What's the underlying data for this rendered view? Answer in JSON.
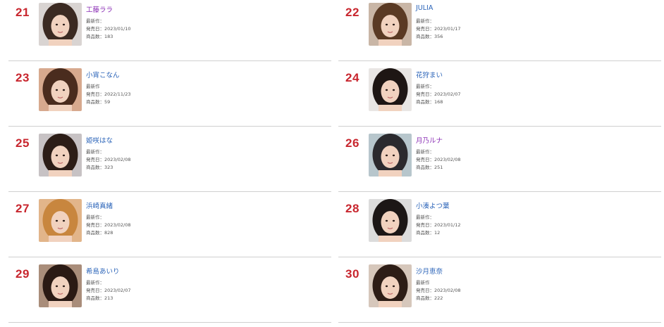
{
  "ranking": [
    {
      "rank": "21",
      "name": "工藤ララ",
      "latest_label": "最新作：",
      "release_label": "発売日：",
      "release_date": "2023/01/10",
      "count_label": "商品数：",
      "count": "183",
      "name_color": "#8b2fb5",
      "hair": "#3b2a22",
      "bg": "#d9d4d2"
    },
    {
      "rank": "22",
      "name": "JULIA",
      "latest_label": "最新作：",
      "release_label": "発売日：",
      "release_date": "2023/01/17",
      "count_label": "商品数：",
      "count": "356",
      "name_color": "#2a63b8",
      "hair": "#5a3a24",
      "bg": "#c9b6a6"
    },
    {
      "rank": "23",
      "name": "小宵こなん",
      "latest_label": "最新作",
      "release_label": "発売日：",
      "release_date": "2022/11/23",
      "count_label": "商品数：",
      "count": "59",
      "name_color": "#2a63b8",
      "hair": "#4a2c1e",
      "bg": "#d7a98e"
    },
    {
      "rank": "24",
      "name": "花狩まい",
      "latest_label": "最新作：",
      "release_label": "発売日：",
      "release_date": "2023/02/07",
      "count_label": "商品数：",
      "count": "168",
      "name_color": "#2a63b8",
      "hair": "#1e1614",
      "bg": "#e9e6e4"
    },
    {
      "rank": "25",
      "name": "姫咲はな",
      "latest_label": "最新作：",
      "release_label": "発売日：",
      "release_date": "2023/02/08",
      "count_label": "商品数：",
      "count": "323",
      "name_color": "#2a63b8",
      "hair": "#2c1d17",
      "bg": "#c7c2c4"
    },
    {
      "rank": "26",
      "name": "月乃ルナ",
      "latest_label": "最新作：",
      "release_label": "発売日：",
      "release_date": "2023/02/08",
      "count_label": "商品数：",
      "count": "251",
      "name_color": "#8b2fb5",
      "hair": "#2b2a2e",
      "bg": "#b7c6cc"
    },
    {
      "rank": "27",
      "name": "浜崎真緒",
      "latest_label": "最新作：",
      "release_label": "発売日：",
      "release_date": "2023/02/08",
      "count_label": "商品数：",
      "count": "828",
      "name_color": "#2a63b8",
      "hair": "#c8863e",
      "bg": "#e2b58a"
    },
    {
      "rank": "28",
      "name": "小湊よつ葉",
      "latest_label": "最新作：",
      "release_label": "発売日：",
      "release_date": "2023/01/12",
      "count_label": "商品数：",
      "count": "12",
      "name_color": "#2a63b8",
      "hair": "#1c1716",
      "bg": "#dcdcdc"
    },
    {
      "rank": "29",
      "name": "希島あいり",
      "latest_label": "最新作：",
      "release_label": "発売日：",
      "release_date": "2023/02/07",
      "count_label": "商品数：",
      "count": "213",
      "name_color": "#2a63b8",
      "hair": "#2a1a14",
      "bg": "#a98d7a"
    },
    {
      "rank": "30",
      "name": "沙月恵奈",
      "latest_label": "最新作",
      "release_label": "発売日：",
      "release_date": "2023/02/08",
      "count_label": "商品数：",
      "count": "222",
      "name_color": "#2a63b8",
      "hair": "#2d1d16",
      "bg": "#d6c7bb"
    }
  ]
}
